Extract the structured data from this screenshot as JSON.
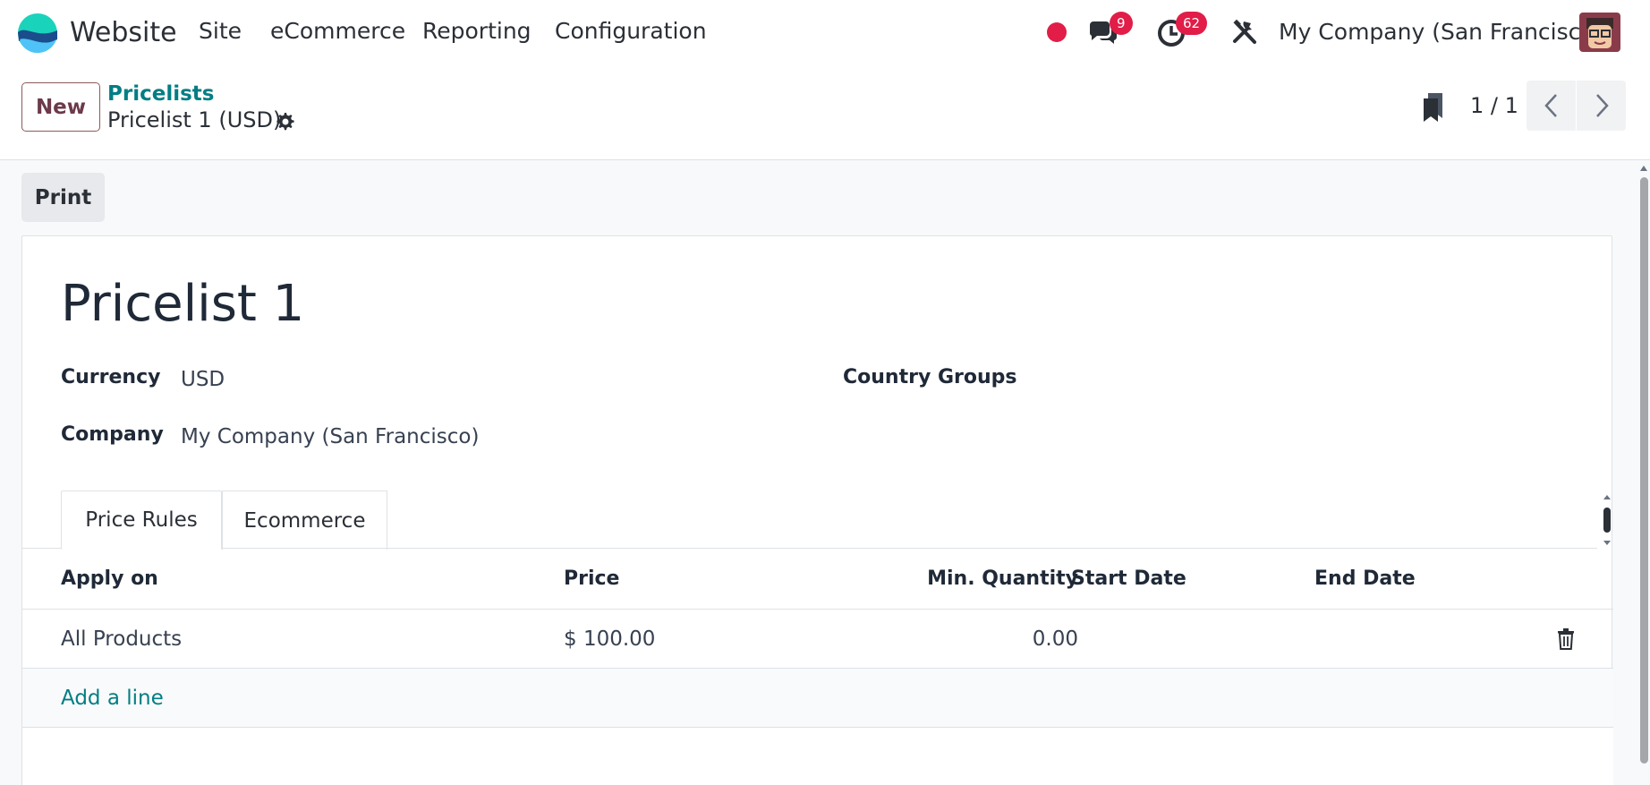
{
  "navbar": {
    "app_name": "Website",
    "menus": [
      "Site",
      "eCommerce",
      "Reporting",
      "Configuration"
    ],
    "messages_count": "9",
    "activities_count": "62",
    "company": "My Company (San Francisco)",
    "accent_color": "#017e84",
    "badge_color": "#e11d48"
  },
  "control_panel": {
    "new_label": "New",
    "breadcrumb_parent": "Pricelists",
    "record_name": "Pricelist 1 (USD)",
    "pager": "1 / 1"
  },
  "toolbar": {
    "print_label": "Print"
  },
  "form": {
    "title": "Pricelist 1",
    "currency_label": "Currency",
    "currency_value": "USD",
    "company_label": "Company",
    "company_value": "My Company (San Francisco)",
    "country_groups_label": "Country Groups"
  },
  "tabs": [
    {
      "label": "Price Rules",
      "active": true
    },
    {
      "label": "Ecommerce",
      "active": false
    }
  ],
  "table": {
    "headers": [
      "Apply on",
      "Price",
      "Min. Quantity",
      "Start Date",
      "End Date"
    ],
    "rows": [
      {
        "apply_on": "All Products",
        "price": "$ 100.00",
        "min_qty": "0.00",
        "start": "",
        "end": ""
      }
    ],
    "add_line_label": "Add a line"
  }
}
